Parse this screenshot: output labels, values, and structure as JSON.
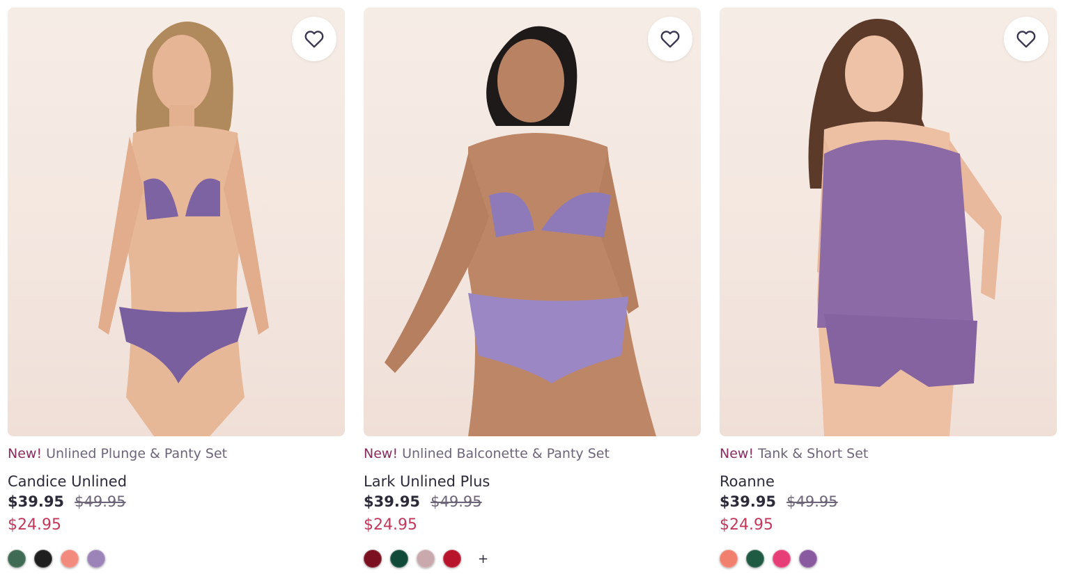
{
  "products": [
    {
      "new_label": "New!",
      "tagline": "Unlined Plunge & Panty Set",
      "name": "Candice Unlined",
      "price": "$39.95",
      "original_price": "$49.95",
      "sale_price": "$24.95",
      "swatches": [
        "#3f6b55",
        "#1f1f1f",
        "#f28a7d",
        "#9c84b8"
      ],
      "more": ""
    },
    {
      "new_label": "New!",
      "tagline": "Unlined Balconette & Panty Set",
      "name": "Lark Unlined Plus",
      "price": "$39.95",
      "original_price": "$49.95",
      "sale_price": "$24.95",
      "swatches": [
        "#7a1020",
        "#124a3a",
        "#c9a9ad",
        "#b8152c"
      ],
      "more": "+"
    },
    {
      "new_label": "New!",
      "tagline": "Tank & Short Set",
      "name": "Roanne",
      "price": "$39.95",
      "original_price": "$49.95",
      "sale_price": "$24.95",
      "swatches": [
        "#f2806e",
        "#1f5a42",
        "#e83e78",
        "#8a5aa0"
      ],
      "more": ""
    }
  ],
  "icons": {
    "favorite": "heart-icon"
  },
  "colors": {
    "accent_new": "#8a2b5e",
    "sale": "#c2385b",
    "text": "#2b2b3a",
    "muted": "#6e6478"
  }
}
